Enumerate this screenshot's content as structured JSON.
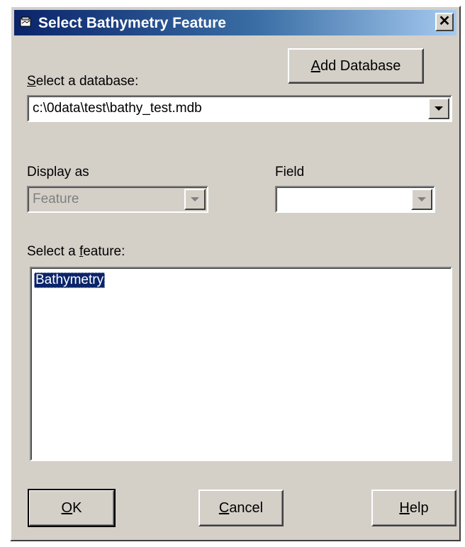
{
  "window": {
    "title": "Select Bathymetry Feature",
    "close_label": "✕"
  },
  "buttons": {
    "add_database": {
      "prefix": "",
      "mnemonic": "A",
      "rest": "dd Database"
    },
    "ok": {
      "prefix": "",
      "mnemonic": "O",
      "rest": "K"
    },
    "cancel": {
      "prefix": "",
      "mnemonic": "C",
      "rest": "ancel"
    },
    "help": {
      "prefix": "",
      "mnemonic": "H",
      "rest": "elp"
    }
  },
  "database": {
    "label_prefix": "",
    "label_mnemonic": "S",
    "label_rest": "elect a database:",
    "value": "c:\\0data\\test\\bathy_test.mdb"
  },
  "display_as": {
    "label": "Display as",
    "value": "Feature"
  },
  "field": {
    "label": "Field",
    "value": ""
  },
  "feature": {
    "label_prefix": "Select a ",
    "label_mnemonic": "f",
    "label_rest": "eature:",
    "items": [
      "Bathymetry"
    ]
  }
}
